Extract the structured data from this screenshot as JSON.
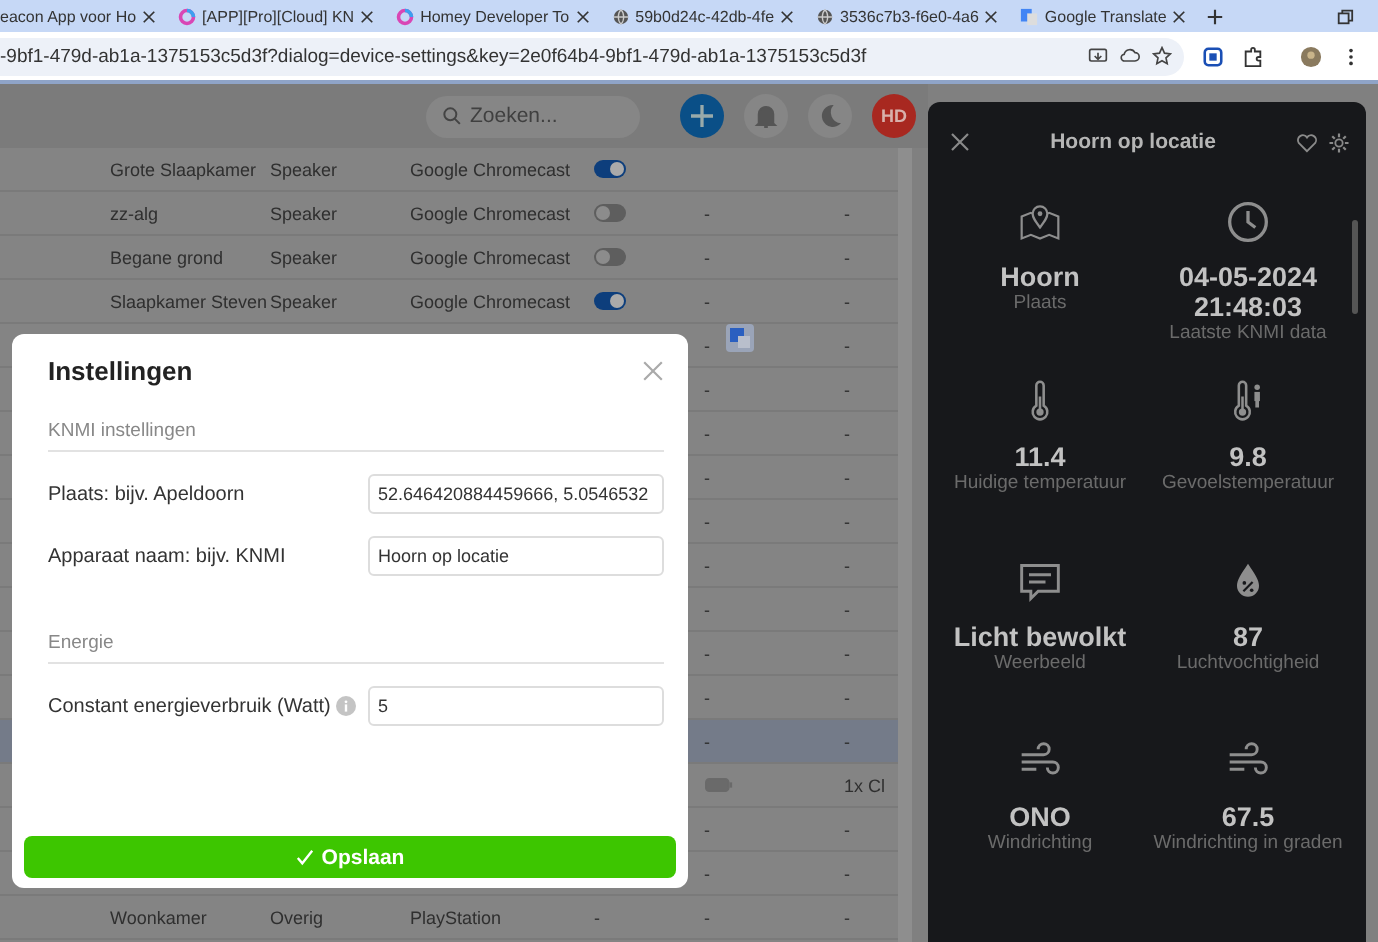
{
  "browser": {
    "tabs": [
      {
        "title": "eacon App voor Ho",
        "kind": "plain"
      },
      {
        "title": "[APP][Pro][Cloud] KN",
        "kind": "ring"
      },
      {
        "title": "Homey Developer To",
        "kind": "ring"
      },
      {
        "title": "59b0d24c-42db-4fe",
        "kind": "globe"
      },
      {
        "title": "3536c7b3-f6e0-4a6",
        "kind": "globe"
      },
      {
        "title": "Google Translate",
        "kind": "translate"
      }
    ],
    "url": "-9bf1-479d-ab1a-1375153c5d3f?dialog=device-settings&key=2e0f64b4-9bf1-479d-ab1a-1375153c5d3f"
  },
  "header": {
    "search": {
      "placeholder": "Zoeken..."
    },
    "avatar": "HD"
  },
  "rows": [
    {
      "kind": "device",
      "selected": false,
      "name": "Grote Slaapkamer",
      "type": "Speaker",
      "driver": "Google Chromecast",
      "toggle": {
        "on": true
      }
    },
    {
      "kind": "device",
      "selected": false,
      "name": "zz-alg",
      "type": "Speaker",
      "driver": "Google Chromecast",
      "toggle": {
        "on": false
      },
      "col5": "-",
      "col6": "-"
    },
    {
      "kind": "device",
      "selected": false,
      "name": "Begane grond",
      "type": "Speaker",
      "driver": "Google Chromecast",
      "toggle": {
        "on": false
      },
      "col5": "-",
      "col6": "-"
    },
    {
      "kind": "device",
      "selected": false,
      "name": "Slaapkamer Steven",
      "type": "Speaker",
      "driver": "Google Chromecast",
      "toggle": {
        "on": true
      },
      "col5": "-",
      "col6": "-"
    },
    {
      "kind": "device",
      "selected": false,
      "col5": "-",
      "col6": "-"
    },
    {
      "kind": "device",
      "selected": false,
      "col5": "-",
      "col6": "-"
    },
    {
      "kind": "device",
      "selected": false,
      "col5": "-",
      "col6": "-"
    },
    {
      "kind": "device",
      "selected": false,
      "col5": "-",
      "col6": "-"
    },
    {
      "kind": "device",
      "selected": false,
      "col5": "-",
      "col6": "-"
    },
    {
      "kind": "device",
      "selected": false,
      "col5": "-",
      "col6": "-"
    },
    {
      "kind": "device",
      "selected": false,
      "col5": "-",
      "col6": "-"
    },
    {
      "kind": "device",
      "selected": false,
      "col5": "-",
      "col6": "-"
    },
    {
      "kind": "device",
      "selected": false,
      "col5": "-",
      "col6": "-"
    },
    {
      "kind": "device",
      "selected": true,
      "col5": "-",
      "col6": "-"
    },
    {
      "kind": "battery",
      "selected": false,
      "col6": "1x Cl"
    },
    {
      "kind": "device",
      "selected": false,
      "col5": "-",
      "col6": "-"
    },
    {
      "kind": "device",
      "selected": false,
      "col5": "-",
      "col6": "-"
    },
    {
      "kind": "device",
      "selected": false,
      "name": "Woonkamer",
      "type": "Overig",
      "driver": "PlayStation",
      "col4": "-",
      "col5": "-",
      "col6": "-"
    }
  ],
  "modal": {
    "title": "Instellingen",
    "sections": [
      {
        "heading": "KNMI instellingen",
        "fields": [
          {
            "label": "Plaats: bijv. Apeldoorn",
            "value": "52.646420884459666, 5.0546532",
            "info": false
          },
          {
            "label": "Apparaat naam: bijv. KNMI",
            "value": "Hoorn op locatie",
            "info": false
          }
        ]
      },
      {
        "heading": "Energie",
        "fields": [
          {
            "label": "Constant energieverbruik (Watt)",
            "value": "5",
            "info": true
          }
        ]
      }
    ],
    "button": "Opslaan"
  },
  "panel": {
    "title": "Hoorn op locatie",
    "tiles": [
      {
        "kind": "map",
        "value": "Hoorn",
        "label": "Plaats"
      },
      {
        "kind": "clock",
        "value": "04-05-2024 21:48:03",
        "label": "Laatste KNMI data"
      },
      {
        "kind": "thermometer",
        "value": "11.4",
        "label": "Huidige temperatuur"
      },
      {
        "kind": "feels",
        "value": "9.8",
        "label": "Gevoelstemperatuur"
      },
      {
        "kind": "message",
        "value": "Licht bewolkt",
        "label": "Weerbeeld"
      },
      {
        "kind": "humidity",
        "value": "87",
        "label": "Luchtvochtigheid"
      },
      {
        "kind": "wind",
        "value": "ONO",
        "label": "Windrichting"
      },
      {
        "kind": "wind",
        "value": "67.5",
        "label": "Windrichting in graden"
      }
    ]
  }
}
